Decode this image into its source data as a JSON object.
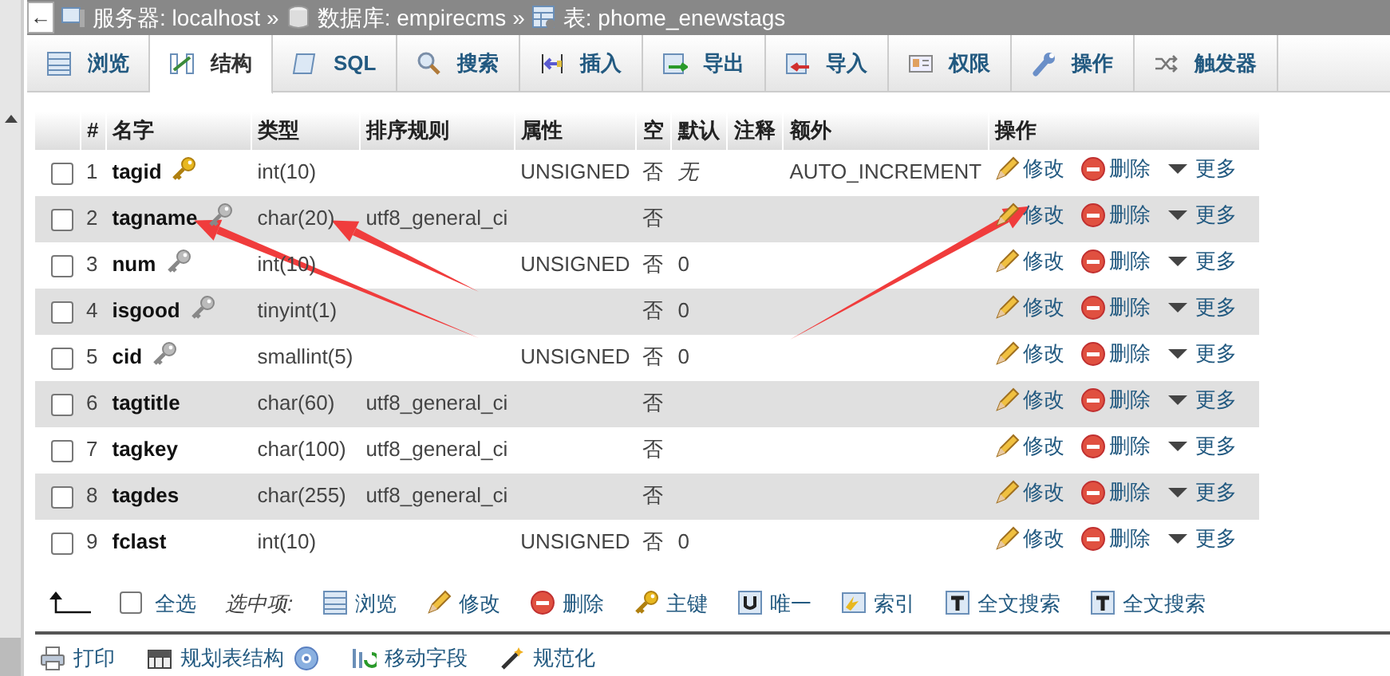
{
  "breadcrumb": {
    "back": "←",
    "parts": [
      {
        "kind": "server",
        "text": "服务器: localhost"
      },
      {
        "kind": "sep",
        "text": "»"
      },
      {
        "kind": "database",
        "text": "数据库: empirecms"
      },
      {
        "kind": "sep",
        "text": "»"
      },
      {
        "kind": "table",
        "text": "表: phome_enewstags"
      }
    ]
  },
  "tabs": [
    {
      "label": "浏览",
      "selected": false
    },
    {
      "label": "结构",
      "selected": true
    },
    {
      "label": "SQL",
      "selected": false
    },
    {
      "label": "搜索",
      "selected": false
    },
    {
      "label": "插入",
      "selected": false
    },
    {
      "label": "导出",
      "selected": false
    },
    {
      "label": "导入",
      "selected": false
    },
    {
      "label": "权限",
      "selected": false
    },
    {
      "label": "操作",
      "selected": false
    },
    {
      "label": "触发器",
      "selected": false
    }
  ],
  "table": {
    "columns": [
      "#",
      "名字",
      "类型",
      "排序规则",
      "属性",
      "空",
      "默认",
      "注释",
      "额外",
      "操作"
    ],
    "rows": [
      {
        "checked": false,
        "num": "1",
        "name": "tagid",
        "kind": "primary",
        "type": "int(10)",
        "attributes": "UNSIGNED",
        "null": "否",
        "default": "无",
        "default_is_none": true,
        "extra": "AUTO_INCREMENT",
        "actions": [
          {
            "kind": "edit",
            "label": "修改"
          },
          {
            "kind": "drop",
            "label": "删除"
          },
          {
            "kind": "more",
            "label": "更多"
          }
        ]
      },
      {
        "checked": false,
        "num": "2",
        "name": "tagname",
        "kind": "index",
        "type": "char(20)",
        "collation": "utf8_general_ci",
        "null": "否",
        "actions": [
          {
            "kind": "edit",
            "label": "修改"
          },
          {
            "kind": "drop",
            "label": "删除"
          },
          {
            "kind": "more",
            "label": "更多"
          }
        ]
      },
      {
        "checked": false,
        "num": "3",
        "name": "num",
        "kind": "index",
        "type": "int(10)",
        "attributes": "UNSIGNED",
        "null": "否",
        "default": "0",
        "default_is_none": false,
        "actions": [
          {
            "kind": "edit",
            "label": "修改"
          },
          {
            "kind": "drop",
            "label": "删除"
          },
          {
            "kind": "more",
            "label": "更多"
          }
        ]
      },
      {
        "checked": false,
        "num": "4",
        "name": "isgood",
        "kind": "index",
        "type": "tinyint(1)",
        "null": "否",
        "default": "0",
        "default_is_none": false,
        "actions": [
          {
            "kind": "edit",
            "label": "修改"
          },
          {
            "kind": "drop",
            "label": "删除"
          },
          {
            "kind": "more",
            "label": "更多"
          }
        ]
      },
      {
        "checked": false,
        "num": "5",
        "name": "cid",
        "kind": "index",
        "type": "smallint(5)",
        "attributes": "UNSIGNED",
        "null": "否",
        "default": "0",
        "default_is_none": false,
        "actions": [
          {
            "kind": "edit",
            "label": "修改"
          },
          {
            "kind": "drop",
            "label": "删除"
          },
          {
            "kind": "more",
            "label": "更多"
          }
        ]
      },
      {
        "checked": false,
        "num": "6",
        "name": "tagtitle",
        "kind": "plain",
        "type": "char(60)",
        "collation": "utf8_general_ci",
        "null": "否",
        "actions": [
          {
            "kind": "edit",
            "label": "修改"
          },
          {
            "kind": "drop",
            "label": "删除"
          },
          {
            "kind": "more",
            "label": "更多"
          }
        ]
      },
      {
        "checked": false,
        "num": "7",
        "name": "tagkey",
        "kind": "plain",
        "type": "char(100)",
        "collation": "utf8_general_ci",
        "null": "否",
        "actions": [
          {
            "kind": "edit",
            "label": "修改"
          },
          {
            "kind": "drop",
            "label": "删除"
          },
          {
            "kind": "more",
            "label": "更多"
          }
        ]
      },
      {
        "checked": false,
        "num": "8",
        "name": "tagdes",
        "kind": "plain",
        "type": "char(255)",
        "collation": "utf8_general_ci",
        "null": "否",
        "actions": [
          {
            "kind": "edit",
            "label": "修改"
          },
          {
            "kind": "drop",
            "label": "删除"
          },
          {
            "kind": "more",
            "label": "更多"
          }
        ]
      },
      {
        "checked": false,
        "num": "9",
        "name": "fclast",
        "kind": "plain",
        "type": "int(10)",
        "attributes": "UNSIGNED",
        "null": "否",
        "default": "0",
        "default_is_none": false,
        "actions": [
          {
            "kind": "edit",
            "label": "修改"
          },
          {
            "kind": "drop",
            "label": "删除"
          },
          {
            "kind": "more",
            "label": "更多"
          }
        ]
      }
    ]
  },
  "bulk": {
    "select_all": {
      "label": "全选",
      "checked": false
    },
    "with_selected": "选中项:",
    "actions": [
      {
        "kind": "browse",
        "label": "浏览"
      },
      {
        "kind": "edit",
        "label": "修改"
      },
      {
        "kind": "drop",
        "label": "删除"
      },
      {
        "kind": "primary",
        "label": "主键"
      },
      {
        "kind": "unique",
        "label": "唯一"
      },
      {
        "kind": "index",
        "label": "索引"
      },
      {
        "kind": "fulltext",
        "label": "全文搜索"
      },
      {
        "kind": "fulltext",
        "label": "全文搜索"
      }
    ]
  },
  "bottom_links": [
    {
      "kind": "print",
      "label": "打印"
    },
    {
      "kind": "propose",
      "label": "规划表结构"
    },
    {
      "kind": "help"
    },
    {
      "kind": "move",
      "label": "移动字段"
    },
    {
      "kind": "normalize",
      "label": "规范化"
    }
  ],
  "annotations": [
    {
      "kind": "arrow"
    },
    {
      "kind": "arrow"
    },
    {
      "kind": "arrow"
    }
  ]
}
